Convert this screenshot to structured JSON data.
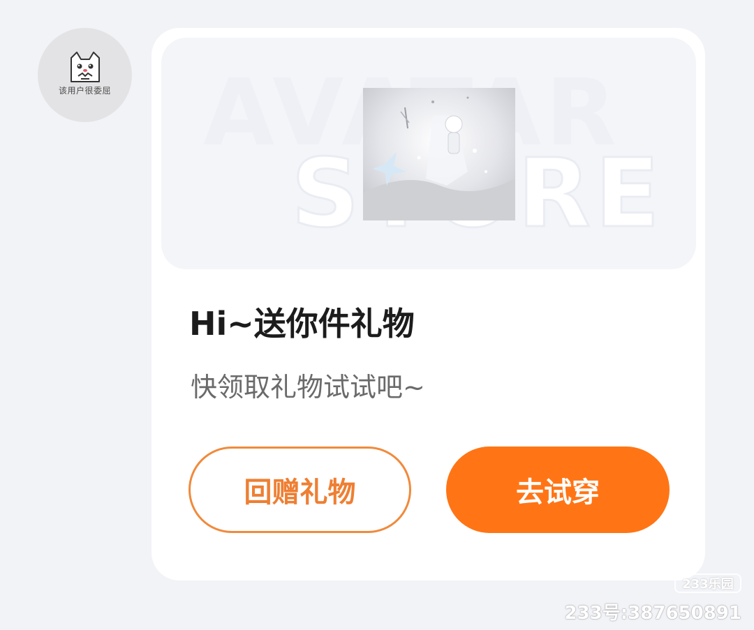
{
  "avatar": {
    "caption": "该用户很委屈",
    "icon": "sad-cat-icon"
  },
  "card": {
    "banner": {
      "word_top": "AVATAR",
      "word_bottom": "STORE",
      "image_icon": "gift-outfit-thumbnail"
    },
    "title": "Hi~送你件礼物",
    "subtitle": "快领取礼物试试吧~",
    "buttons": {
      "return_gift": "回赠礼物",
      "try_on": "去试穿"
    }
  },
  "watermark": {
    "badge": "233乐园",
    "id_text": "233号:387650891"
  },
  "colors": {
    "accent": "#ff7515",
    "accent_outline": "#f08a3c",
    "background": "#f2f3f7"
  }
}
